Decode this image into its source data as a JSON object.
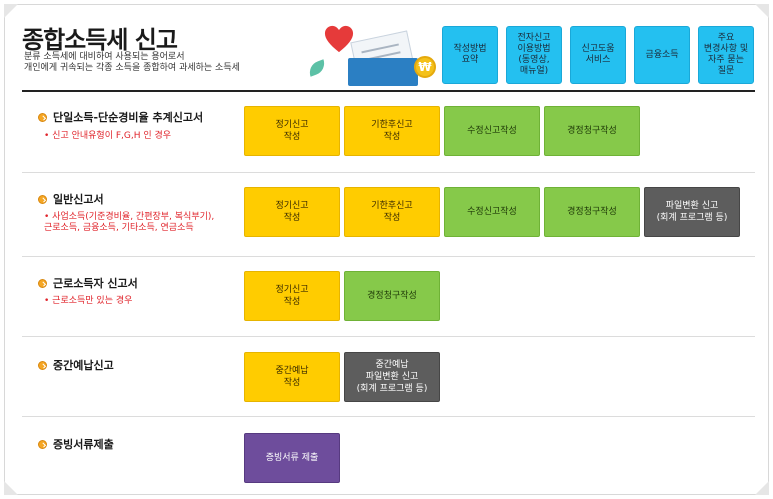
{
  "header": {
    "title": "종합소득세 신고",
    "desc_line1": "분류 소득세에 대비하여 사용되는 용어로서",
    "desc_line2": "개인에게 귀속되는 각종 소득을 종합하여 과세하는 소득세",
    "illustration_coin": "₩"
  },
  "top_buttons": [
    {
      "label": "작성방법\n요약"
    },
    {
      "label": "전자신고\n이용방법\n(동영상,\n매뉴얼)"
    },
    {
      "label": "신고도움\n서비스"
    },
    {
      "label": "금융소득"
    },
    {
      "label": "주요\n변경사항 및\n자주 묻는\n질문"
    }
  ],
  "sections": [
    {
      "title": "단일소득-단순경비율 추계신고서",
      "note": "• 신고 안내유형이 F,G,H 인 경우",
      "buttons": [
        {
          "label": "정기신고\n작성",
          "color": "#ffcc00"
        },
        {
          "label": "기한후신고\n작성",
          "color": "#ffcc00"
        },
        {
          "label": "수정신고작성",
          "color": "#86c94a"
        },
        {
          "label": "경정청구작성",
          "color": "#86c94a"
        }
      ]
    },
    {
      "title": "일반신고서",
      "note": "• 사업소득(기준경비율, 간편장부, 복식부기),\n근로소득, 금융소득, 기타소득, 연금소득",
      "buttons": [
        {
          "label": "정기신고\n작성",
          "color": "#ffcc00"
        },
        {
          "label": "기한후신고\n작성",
          "color": "#ffcc00"
        },
        {
          "label": "수정신고작성",
          "color": "#86c94a"
        },
        {
          "label": "경정청구작성",
          "color": "#86c94a"
        },
        {
          "label": "파일변환 신고\n(회계 프로그램 등)",
          "color": "#5d5d5d"
        }
      ]
    },
    {
      "title": "근로소득자 신고서",
      "note": "• 근로소득만 있는 경우",
      "buttons": [
        {
          "label": "정기신고\n작성",
          "color": "#ffcc00"
        },
        {
          "label": "경정청구작성",
          "color": "#86c94a"
        }
      ]
    },
    {
      "title": "중간예납신고",
      "note": "",
      "buttons": [
        {
          "label": "중간예납\n작성",
          "color": "#ffcc00"
        },
        {
          "label": "중간예납\n파일변환 신고\n(회계 프로그램 등)",
          "color": "#5d5d5d"
        }
      ]
    },
    {
      "title": "증빙서류제출",
      "note": "",
      "buttons": [
        {
          "label": "증빙서류 제출",
          "color": "#6e4d9c"
        }
      ]
    }
  ]
}
